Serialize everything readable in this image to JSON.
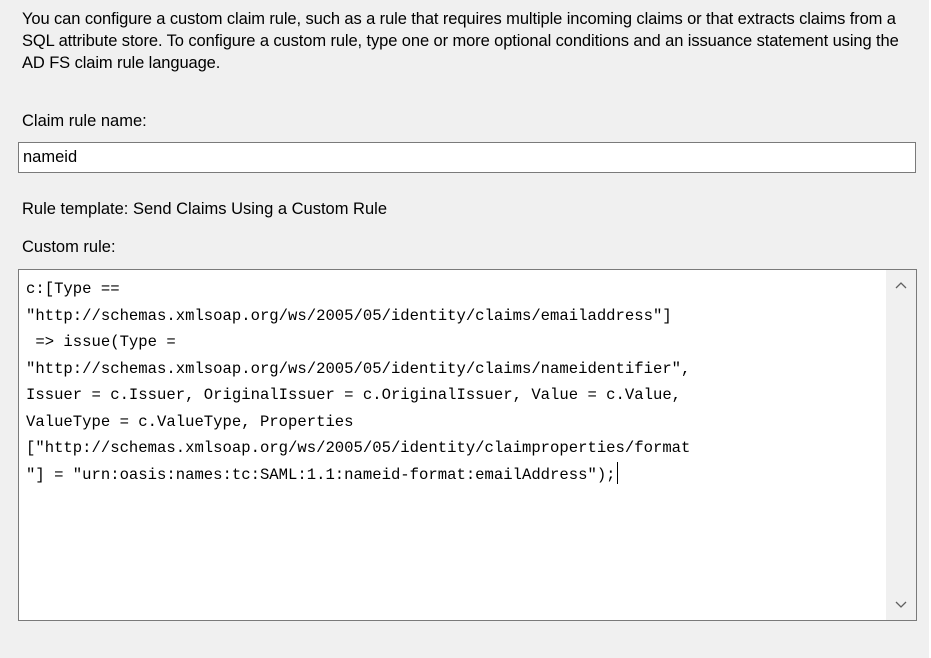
{
  "description": "You can configure a custom claim rule, such as a rule that requires multiple incoming claims or that extracts claims from a SQL attribute store. To configure a custom rule, type one or more optional conditions and an issuance statement using the AD FS claim rule language.",
  "claim_rule_name": {
    "label": "Claim rule name:",
    "value": "nameid"
  },
  "rule_template": "Rule template: Send Claims Using a Custom Rule",
  "custom_rule": {
    "label": "Custom rule:",
    "lines": [
      "c:[Type ==",
      "\"http://schemas.xmlsoap.org/ws/2005/05/identity/claims/emailaddress\"]",
      " => issue(Type =",
      "\"http://schemas.xmlsoap.org/ws/2005/05/identity/claims/nameidentifier\",",
      "Issuer = c.Issuer, OriginalIssuer = c.OriginalIssuer, Value = c.Value,",
      "ValueType = c.ValueType, Properties",
      "[\"http://schemas.xmlsoap.org/ws/2005/05/identity/claimproperties/format",
      "\"] = \"urn:oasis:names:tc:SAML:1.1:nameid-format:emailAddress\");"
    ]
  },
  "icons": {
    "scroll_up": "chevron-up-icon",
    "scroll_down": "chevron-down-icon"
  },
  "colors": {
    "background": "#f0f0f0",
    "field_border": "#7a7a7a",
    "field_background": "#ffffff"
  }
}
